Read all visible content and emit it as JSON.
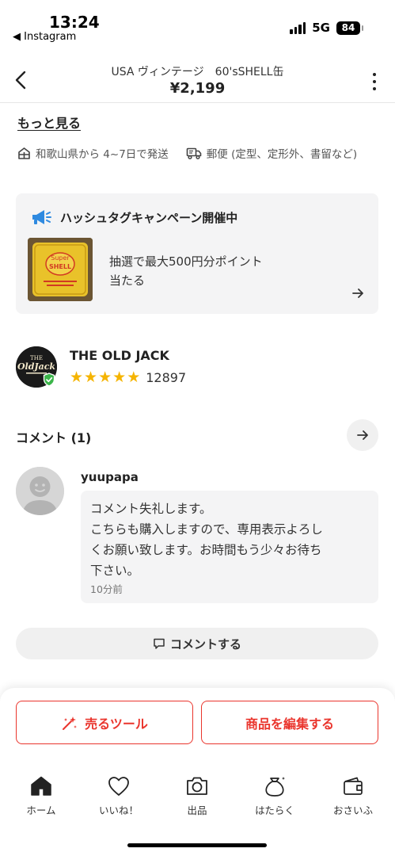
{
  "status_bar": {
    "time": "13:24",
    "back_app": "◀ Instagram",
    "network": "5G",
    "battery": "84"
  },
  "header": {
    "title": "USA ヴィンテージ　60'sSHELL缶",
    "price": "¥2,199"
  },
  "description": {
    "more_link": "もっと見る"
  },
  "shipping": {
    "origin": "和歌山県から 4~7日で発送",
    "method": "郵便 (定型、定形外、書留など)"
  },
  "campaign": {
    "title": "ハッシュタグキャンペーン開催中",
    "line1": "抽選で最大500円分ポイント",
    "line2": "当たる",
    "image_text_top": "Super",
    "image_text_mid": "SHELL"
  },
  "seller": {
    "name": "THE OLD JACK",
    "rating_count": "12897",
    "stars": 5,
    "avatar_text_top": "THE",
    "avatar_text_mid": "OldJack"
  },
  "comments": {
    "heading": "コメント (1)",
    "items": [
      {
        "user": "yuupapa",
        "line1": "コメント失礼します。",
        "line2": "こちらも購入しますので、専用表示よろし",
        "line3": "くお願い致します。お時間もう少々お待ち",
        "line4": "下さい。",
        "time": "10分前"
      }
    ],
    "write_button": "コメントする"
  },
  "actions": {
    "sell_tools": "売るツール",
    "edit_item": "商品を編集する"
  },
  "tabs": [
    {
      "label": "ホーム",
      "icon": "home-icon"
    },
    {
      "label": "いいね！",
      "icon": "heart-icon"
    },
    {
      "label": "出品",
      "icon": "camera-icon"
    },
    {
      "label": "はたらく",
      "icon": "money-bag-icon"
    },
    {
      "label": "おさいふ",
      "icon": "wallet-icon"
    }
  ],
  "colors": {
    "accent": "#ea352d",
    "star": "#f5b400",
    "megaphone": "#2f8ae0",
    "verified": "#3bb54a"
  }
}
